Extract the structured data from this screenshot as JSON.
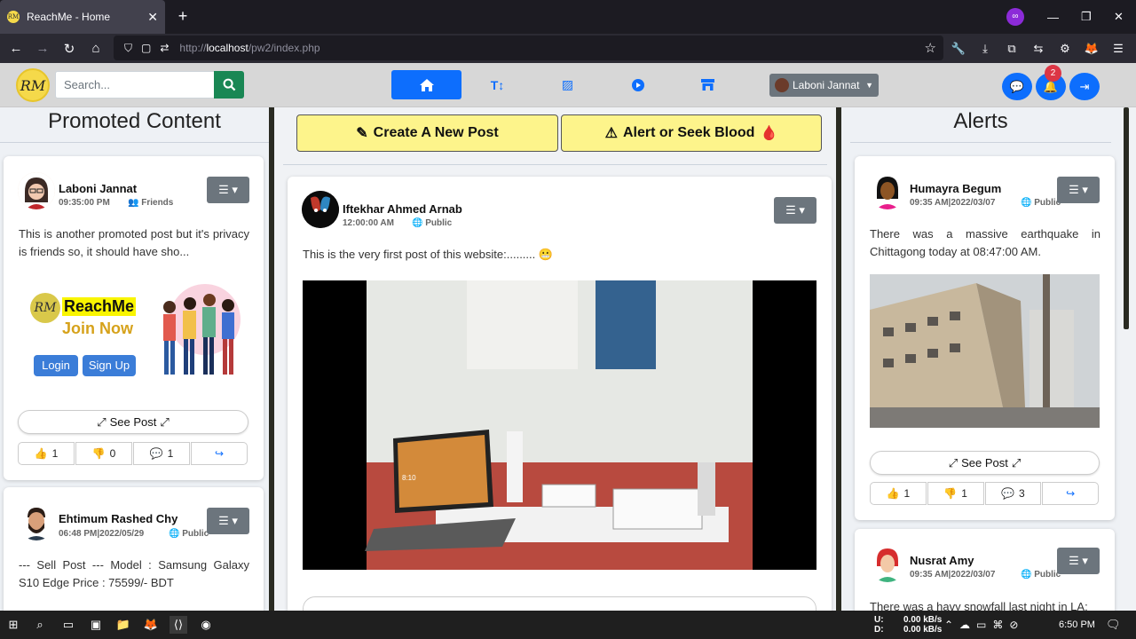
{
  "browser": {
    "tab_title": "ReachMe - Home",
    "url_prefix": "http://",
    "url_host": "localhost",
    "url_path": "/pw2/index.php"
  },
  "header": {
    "logo_text": "RM",
    "search_placeholder": "Search...",
    "user_name": "Laboni Jannat",
    "notification_count": "2"
  },
  "left": {
    "heading": "Promoted Content",
    "post1": {
      "name": "Laboni Jannat",
      "time": "09:35:00 PM",
      "privacy": "Friends",
      "text": "This is another promoted post but it's privacy is friends so, it should have sho...",
      "promo_brand": "ReachMe",
      "promo_join": "Join Now",
      "promo_login": "Login",
      "promo_signup": "Sign Up",
      "see_post": "See Post",
      "likes": "1",
      "dislikes": "0",
      "comments": "1"
    },
    "post2": {
      "name": "Ehtimum Rashed Chy",
      "time": "06:48 PM|2022/05/29",
      "privacy": "Public",
      "text": "--- Sell Post --- Model : Samsung Galaxy S10 Edge Price : 75599/- BDT"
    }
  },
  "middle": {
    "create_post": "Create A New Post",
    "alert_blood": "Alert or Seek Blood",
    "post": {
      "name": "Iftekhar Ahmed Arnab",
      "time": "12:00:00 AM",
      "privacy": "Public",
      "text": "This is the very first post of this website:.........",
      "laptop_time": "8:10"
    }
  },
  "right": {
    "heading": "Alerts",
    "alert1": {
      "name": "Humayra Begum",
      "time": "09:35 AM|2022/03/07",
      "privacy": "Public",
      "text": "There was a massive earthquake in Chittagong today at 08:47:00 AM.",
      "see_post": "See Post",
      "likes": "1",
      "dislikes": "1",
      "comments": "3"
    },
    "alert2": {
      "name": "Nusrat Amy",
      "time": "09:35 AM|2022/03/07",
      "privacy": "Public",
      "text": "There was a havy snowfall last night in LA:"
    }
  },
  "taskbar": {
    "net_up_label": "U:",
    "net_down_label": "D:",
    "net_up": "0.00 kB/s",
    "net_down": "0.00 kB/s",
    "time": "6:50 PM"
  },
  "colors": {
    "primary": "#0d6efd",
    "success": "#198754",
    "secondary": "#6c757d",
    "danger": "#dc3545",
    "action_yellow": "#fdf48b"
  }
}
